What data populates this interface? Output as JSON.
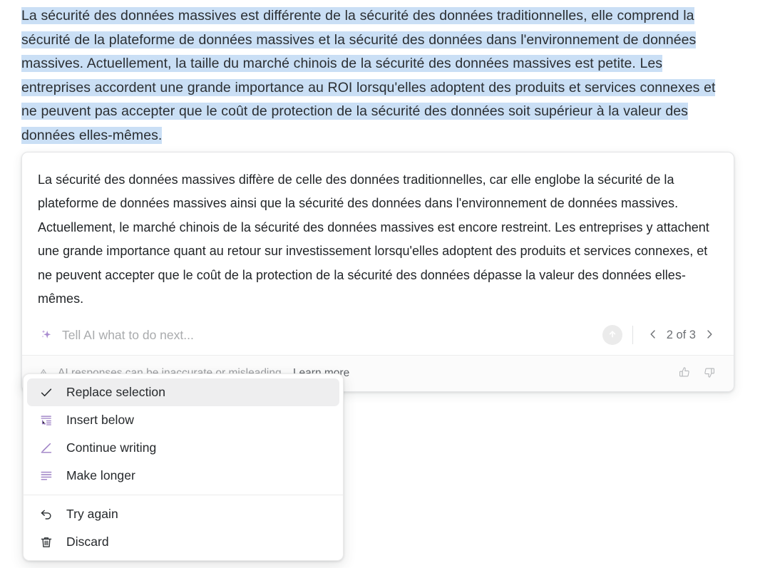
{
  "colors": {
    "selection_highlight": "#cadff5",
    "accent_purple": "#a084c8",
    "text_primary": "#25282b",
    "text_muted": "#9b9da0",
    "menu_active_bg": "#eeeeef",
    "submit_button_bg": "#ebebeb"
  },
  "source_selection": {
    "text": "La sécurité des données massives est différente de la sécurité des données traditionnelles, elle comprend la sécurité de la plateforme de données massives et la sécurité des données dans l'environnement de données massives. Actuellement, la taille du marché chinois de la sécurité des données massives est petite. Les entreprises accordent une grande importance au ROI lorsqu'elles adoptent des produits et services connexes et ne peuvent pas accepter que le coût de protection de la sécurité des données soit supérieur à la valeur des données elles-mêmes."
  },
  "ai_card": {
    "response_text": "La sécurité des données massives diffère de celle des données traditionnelles, car elle englobe la sécurité de la plateforme de données massives ainsi que la sécurité des données dans l'environnement de données massives. Actuellement, le marché chinois de la sécurité des données massives est encore restreint. Les entreprises y attachent une grande importance quant au retour sur investissement lorsqu'elles adoptent des produits et services connexes, et ne peuvent accepter que le coût de la protection de la sécurité des données dépasse la valeur des données elles-mêmes.",
    "prompt": {
      "icon": "sparkle-icon",
      "placeholder": "Tell AI what to do next...",
      "value": ""
    },
    "submit": {
      "icon": "arrow-up-circle-icon",
      "label": "Submit"
    },
    "pager": {
      "prev_icon": "chevron-left-icon",
      "next_icon": "chevron-right-icon",
      "label": "2 of 3",
      "current": 2,
      "total": 3
    },
    "footer": {
      "warning_icon": "warning-triangle-icon",
      "note": "AI responses can be inaccurate or misleading.",
      "learn_more": "Learn more",
      "thumbs_up_icon": "thumbs-up-icon",
      "thumbs_down_icon": "thumbs-down-icon"
    }
  },
  "menu": {
    "items": [
      {
        "label": "Replace selection",
        "icon": "check-icon",
        "active": true
      },
      {
        "label": "Insert below",
        "icon": "insert-below-icon",
        "active": false
      },
      {
        "label": "Continue writing",
        "icon": "pencil-line-icon",
        "active": false
      },
      {
        "label": "Make longer",
        "icon": "make-longer-lines-icon",
        "active": false
      }
    ],
    "secondary_items": [
      {
        "label": "Try again",
        "icon": "undo-arrow-icon"
      },
      {
        "label": "Discard",
        "icon": "trash-icon"
      }
    ]
  }
}
